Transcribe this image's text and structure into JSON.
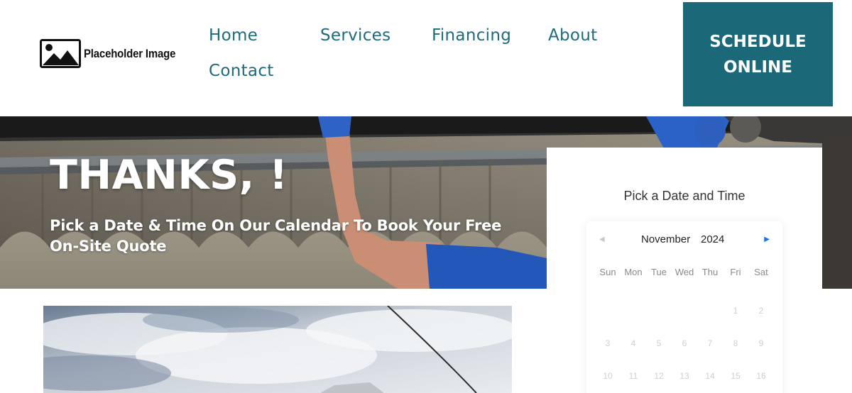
{
  "header": {
    "logo_text": "Placeholder Image",
    "nav": [
      "Home",
      "Services",
      "Financing",
      "About",
      "Contact"
    ],
    "cta_label": "SCHEDULE ONLINE"
  },
  "hero": {
    "title": "THANKS, !",
    "subtitle": "Pick a Date & Time On Our Calendar To Book Your Free On-Site Quote"
  },
  "booking": {
    "title": "Pick a Date and Time",
    "month": "November",
    "year": "2024",
    "weekdays": [
      "Sun",
      "Mon",
      "Tue",
      "Wed",
      "Thu",
      "Fri",
      "Sat"
    ],
    "days": [
      "1",
      "2",
      "3",
      "4",
      "5",
      "6",
      "7",
      "8",
      "9",
      "10",
      "11",
      "12",
      "13",
      "14",
      "15",
      "16"
    ]
  },
  "colors": {
    "brand_teal": "#1b6879",
    "nav_text": "#1e6b7b",
    "next_arrow": "#1a73e8"
  },
  "icons": {
    "logo": "image-placeholder-icon",
    "prev": "triangle-left-icon",
    "next": "triangle-right-icon"
  }
}
